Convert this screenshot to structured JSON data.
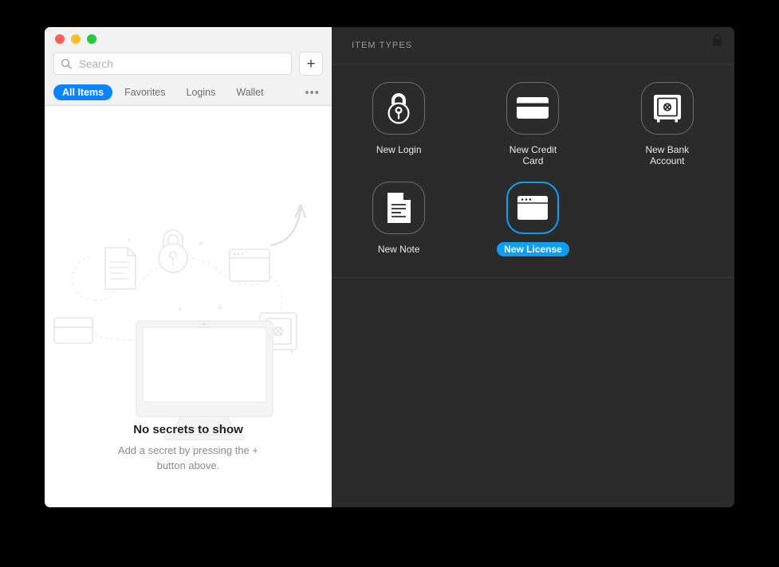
{
  "window": {
    "traffic_lights": [
      {
        "name": "close",
        "color": "#ff5f57"
      },
      {
        "name": "minimize",
        "color": "#febc2e"
      },
      {
        "name": "zoom",
        "color": "#28c840"
      }
    ]
  },
  "search": {
    "placeholder": "Search",
    "value": "",
    "icon": "search-icon"
  },
  "toolbar": {
    "add_label": "+",
    "more_label": "•••"
  },
  "tabs": [
    {
      "label": "All Items",
      "active": true
    },
    {
      "label": "Favorites",
      "active": false
    },
    {
      "label": "Logins",
      "active": false
    },
    {
      "label": "Wallet",
      "active": false
    }
  ],
  "empty_state": {
    "title": "No secrets to show",
    "subtitle": "Add a secret by pressing the + button above."
  },
  "panel": {
    "section_title": "ITEM TYPES",
    "lock_icon": "lock-icon"
  },
  "item_types": [
    {
      "label": "New Login",
      "icon": "padlock-icon",
      "selected": false
    },
    {
      "label": "New Credit Card",
      "icon": "credit-card-icon",
      "selected": false
    },
    {
      "label": "New Bank Account",
      "icon": "safe-icon",
      "selected": false
    },
    {
      "label": "New Note",
      "icon": "document-icon",
      "selected": false
    },
    {
      "label": "New License",
      "icon": "browser-window-icon",
      "selected": true
    }
  ],
  "colors": {
    "accent_blue": "#0a84ff",
    "selection_blue": "#0f9ef0",
    "dark_panel": "#2b2b2b",
    "titlebar": "#f2f2f2"
  }
}
